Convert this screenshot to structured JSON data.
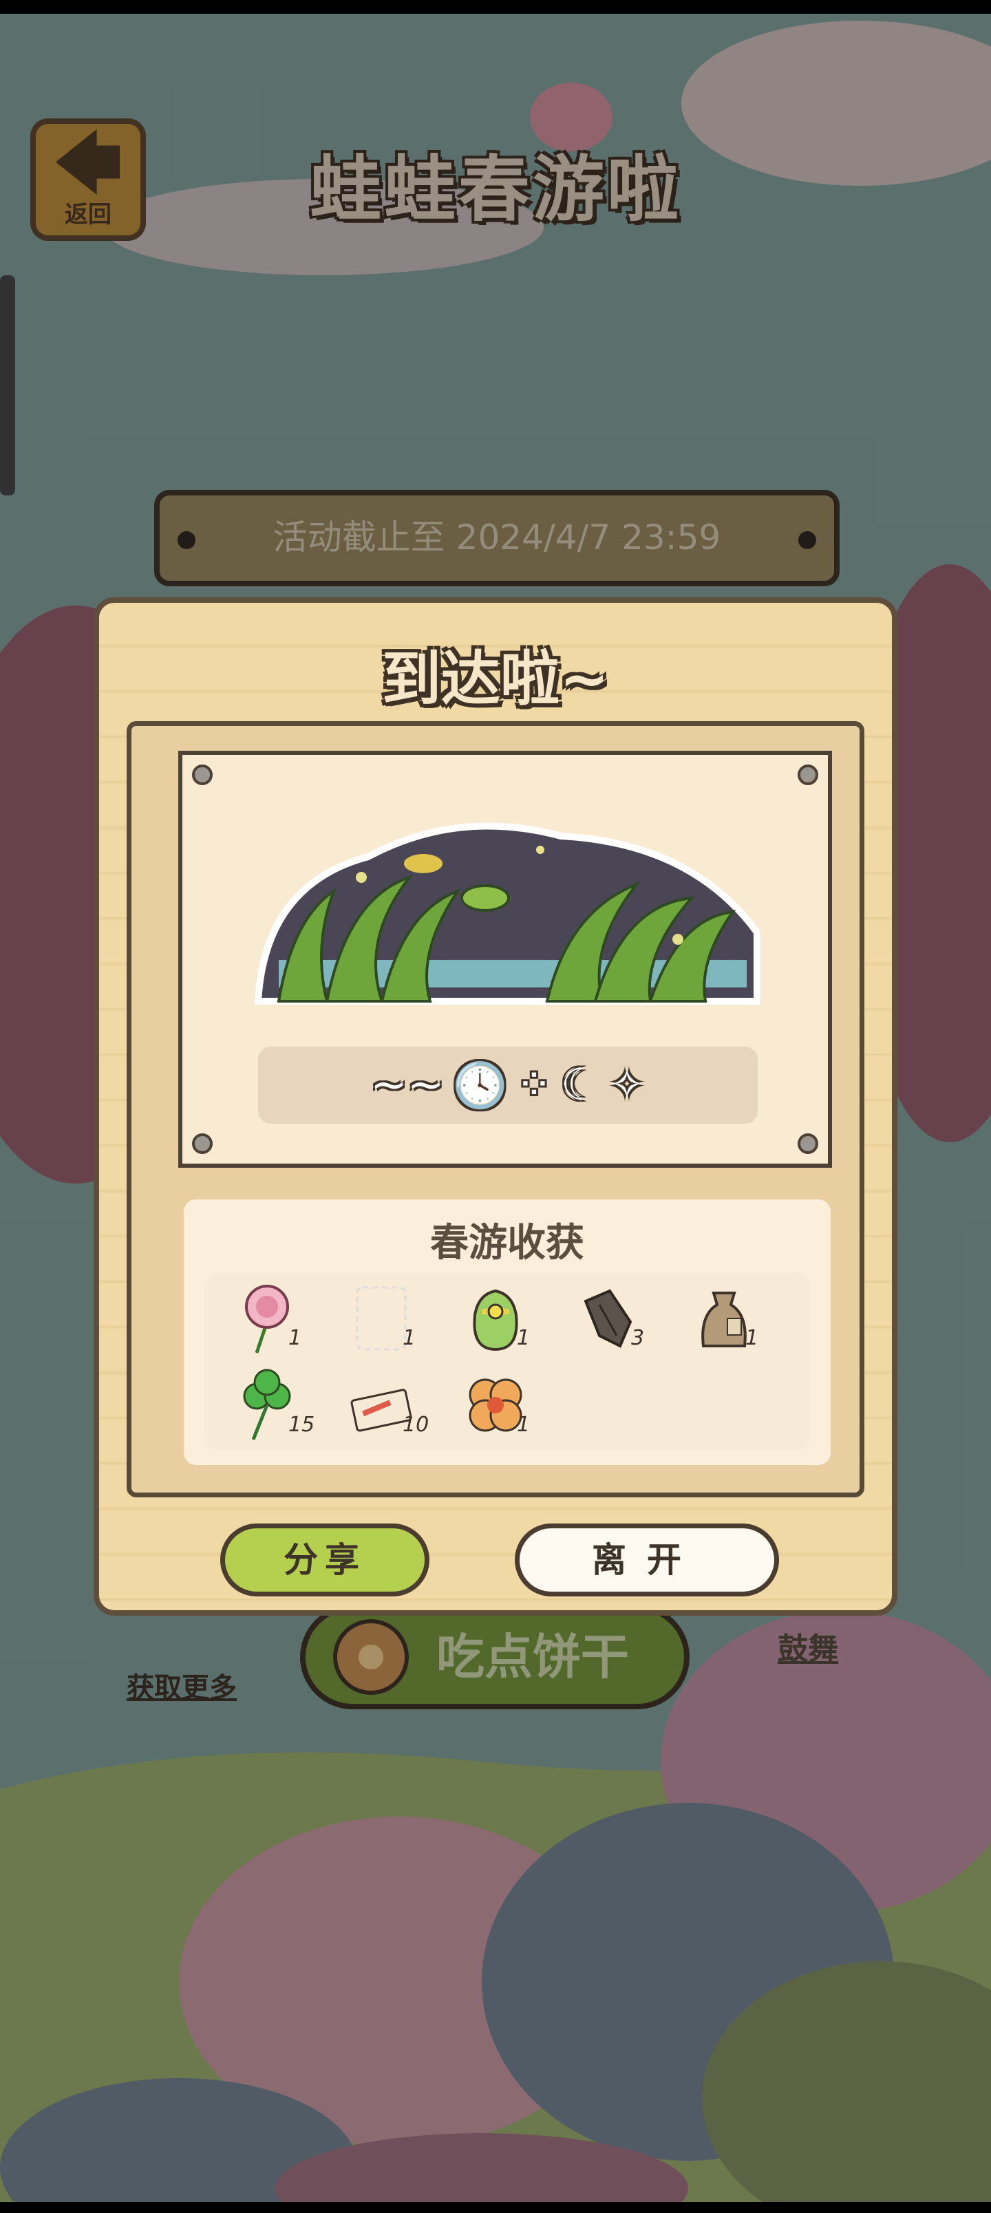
{
  "header": {
    "back_arrow": "🡄",
    "back_label": "返回",
    "title": "蛙蛙春游啦"
  },
  "event": {
    "deadline": "活动截止至 2024/4/7 23:59"
  },
  "dialog": {
    "title": "到达啦~",
    "code_symbols": [
      "~~",
      "🕓",
      "⁘",
      "☾",
      "✧"
    ],
    "harvest_title": "春游收获",
    "items": [
      {
        "icon": "carnation-flower-icon",
        "count": "1"
      },
      {
        "icon": "empty-slot-icon",
        "count": "1"
      },
      {
        "icon": "lucky-bag-icon",
        "count": "1"
      },
      {
        "icon": "wood-piece-icon",
        "count": "3"
      },
      {
        "icon": "seed-sack-icon",
        "count": "1"
      },
      {
        "icon": "clover-icon",
        "count": "15"
      },
      {
        "icon": "ticket-icon",
        "count": "10"
      },
      {
        "icon": "flower-cookie-icon",
        "count": "1"
      }
    ],
    "share_label": "分享",
    "leave_label": "离开"
  },
  "footer": {
    "eat_label": "吃点饼干",
    "get_more_label": "获取更多",
    "cheer_label": "鼓舞"
  },
  "colors": {
    "share_button": "#b5cf4e",
    "dialog_bg": "#f0d9a5",
    "outline": "#4a3c2e"
  }
}
